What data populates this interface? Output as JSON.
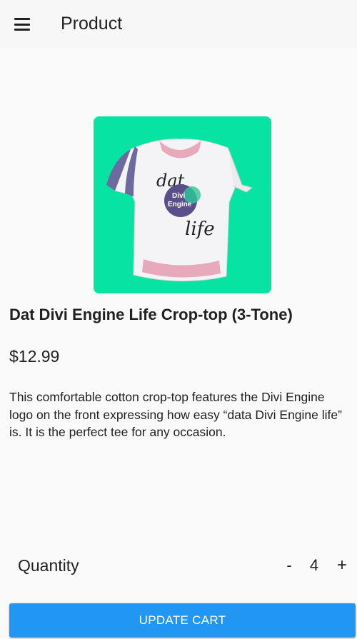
{
  "app_bar": {
    "menu_icon": "hamburger-menu-icon",
    "title": "Product"
  },
  "product": {
    "image_background": "#07e3a2",
    "image_print": {
      "line1": "dat",
      "circle_line1": "Divi",
      "circle_line2": "Engine",
      "line2": "life"
    },
    "name": "Dat Divi Engine Life Crop-top (3-Tone)",
    "price": "$12.99",
    "description": "This comfortable cotton crop-top features the Divi Engine logo on the front expressing how easy “data Divi Engine life” is. It is the perfect tee for any occasion."
  },
  "quantity": {
    "label": "Quantity",
    "decrement_label": "-",
    "value": "4",
    "increment_label": "+"
  },
  "actions": {
    "update_cart_label": "UPDATE CART",
    "accent_color": "#2196f3"
  }
}
